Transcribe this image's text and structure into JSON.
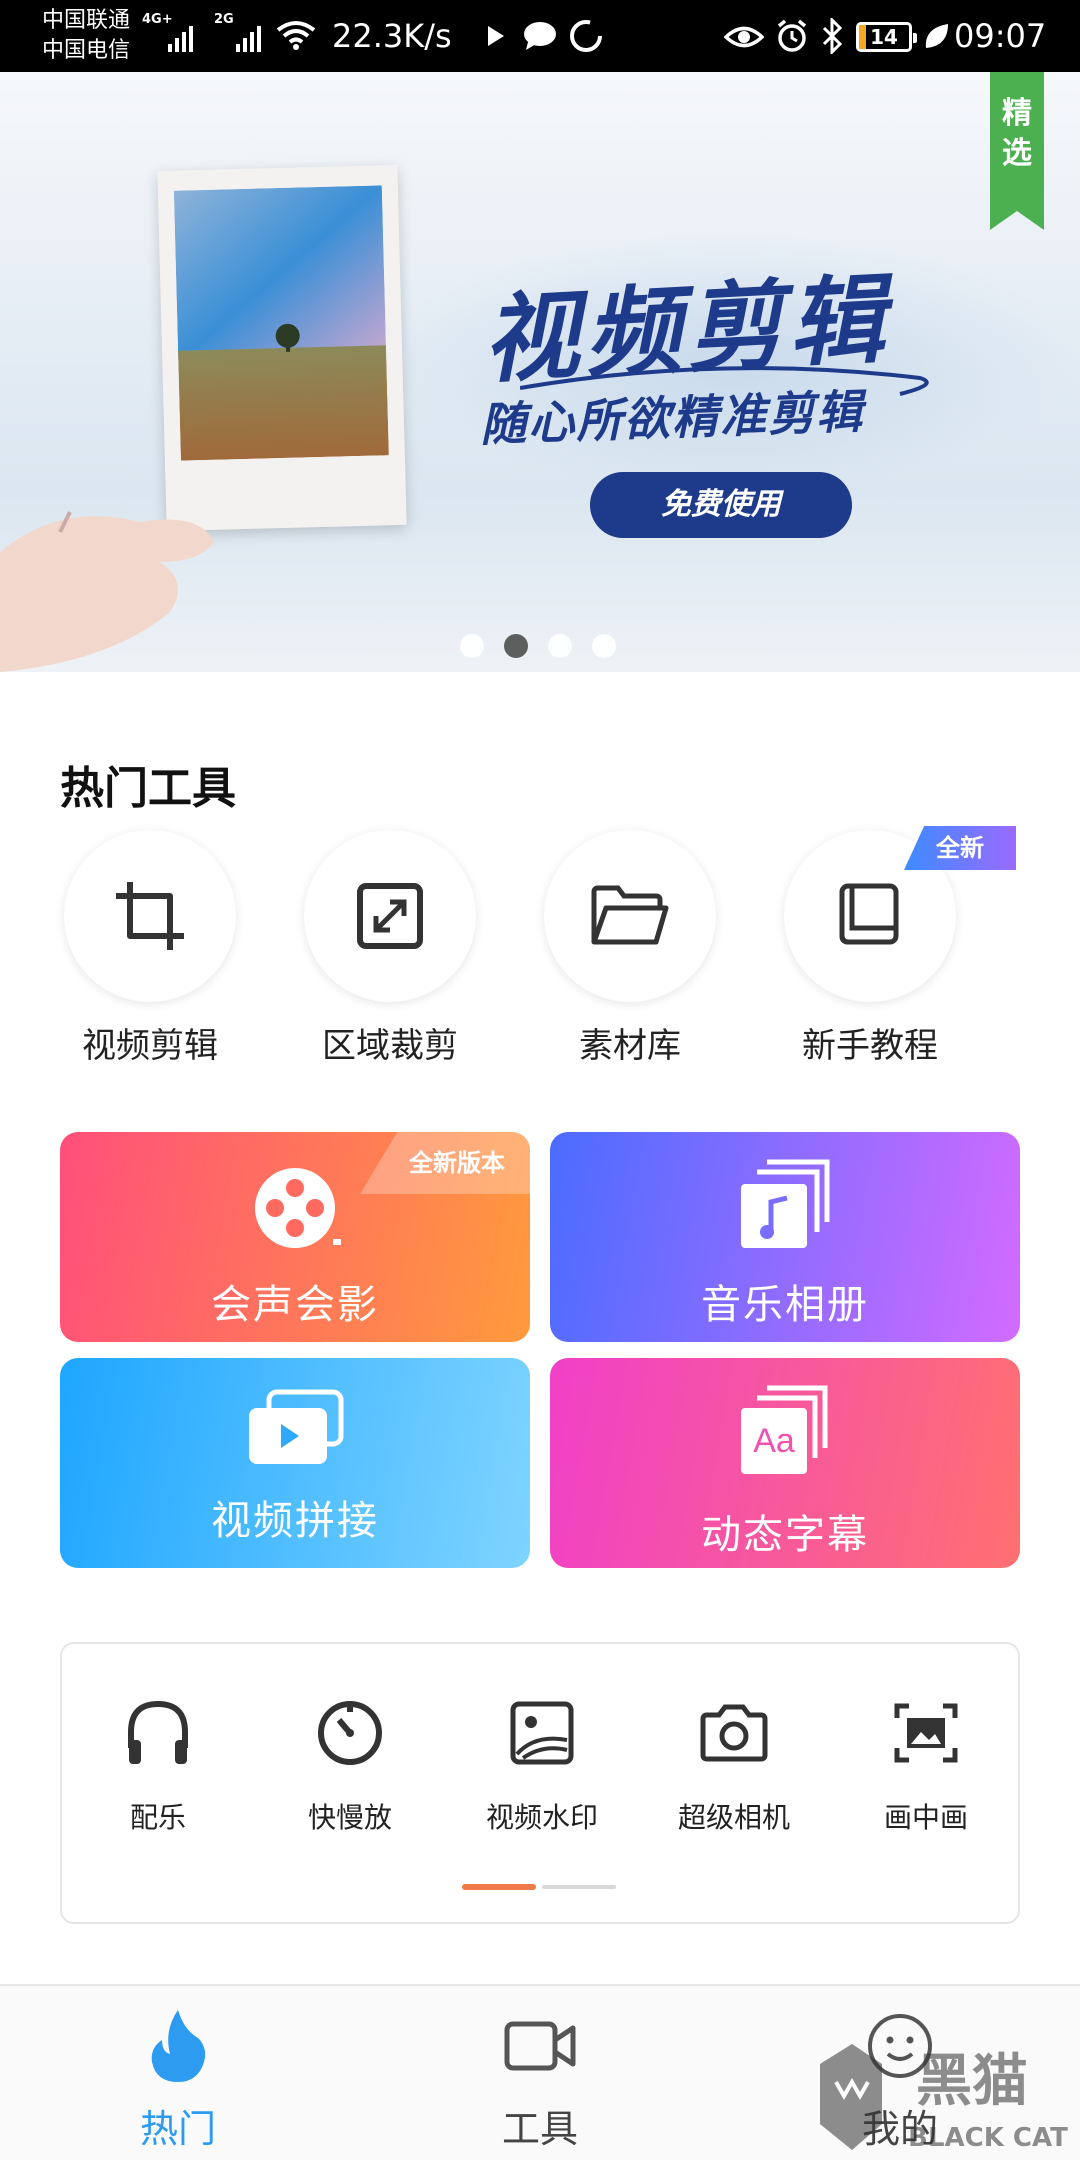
{
  "status_bar": {
    "carrier_1": "中国联通",
    "carrier_2": "中国电信",
    "net_1": "4G+",
    "net_2": "2G",
    "speed": "22.3K/s",
    "battery": "14",
    "battery_level": 0.14,
    "time": "09:07"
  },
  "banner": {
    "ribbon": "精选",
    "title": "视频剪辑",
    "subtitle": "随心所欲精准剪辑",
    "cta": "免费使用",
    "page_count": 4,
    "active_page": 2
  },
  "hot_tools": {
    "title": "热门工具",
    "badge_new": "全新",
    "items": [
      {
        "label": "视频剪辑",
        "icon": "crop-icon"
      },
      {
        "label": "区域裁剪",
        "icon": "expand-icon"
      },
      {
        "label": "素材库",
        "icon": "folder-icon"
      },
      {
        "label": "新手教程",
        "icon": "book-icon"
      }
    ]
  },
  "feature_cards": {
    "badge": "全新版本",
    "items": [
      {
        "label": "会声会影",
        "icon": "film-reel-icon",
        "color_from": "#ff4f7b",
        "color_to": "#ff9a3c"
      },
      {
        "label": "音乐相册",
        "icon": "music-album-icon",
        "color_from": "#4b6cff",
        "color_to": "#d36bff"
      },
      {
        "label": "视频拼接",
        "icon": "video-stack-icon",
        "color_from": "#1ea6ff",
        "color_to": "#7fd4ff"
      },
      {
        "label": "动态字幕",
        "icon": "text-aa-icon",
        "color_from": "#f040c8",
        "color_to": "#ff7070"
      }
    ]
  },
  "tools_panel": {
    "items": [
      {
        "label": "配乐",
        "icon": "headphones-icon"
      },
      {
        "label": "快慢放",
        "icon": "speed-dial-icon"
      },
      {
        "label": "视频水印",
        "icon": "watermark-image-icon"
      },
      {
        "label": "超级相机",
        "icon": "camera-icon"
      },
      {
        "label": "画中画",
        "icon": "picture-in-picture-icon"
      }
    ],
    "pages": 2,
    "active_page": 1
  },
  "bottom_nav": {
    "items": [
      {
        "label": "热门",
        "icon": "flame-icon",
        "active": true
      },
      {
        "label": "工具",
        "icon": "video-camera-icon",
        "active": false
      },
      {
        "label": "我的",
        "icon": "smiley-icon",
        "active": false
      }
    ]
  },
  "watermark": {
    "cn": "黑猫",
    "en": "BLACK CAT"
  },
  "colors": {
    "accent_blue": "#2c9bf0",
    "pager_active": "#f07a4a",
    "banner_navy": "#1e3a8a",
    "ribbon_green": "#4caf50"
  }
}
